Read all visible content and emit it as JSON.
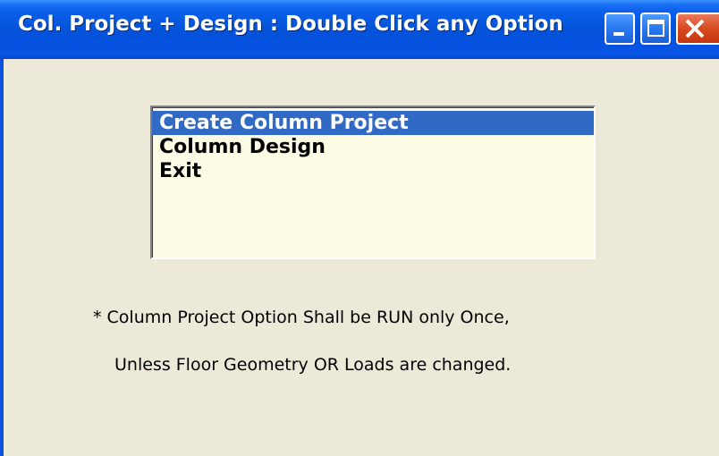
{
  "window": {
    "title": "Col. Project + Design : Double Click any Option",
    "controls": {
      "minimize": "minimize-icon",
      "maximize": "maximize-icon",
      "close": "close-icon"
    }
  },
  "options": {
    "items": [
      {
        "label": "Create Column Project",
        "selected": true
      },
      {
        "label": "Column Design",
        "selected": false
      },
      {
        "label": "Exit",
        "selected": false
      }
    ]
  },
  "note": {
    "line1": "* Column Project Option Shall be RUN only Once,",
    "line2": "Unless Floor Geometry OR Loads are changed."
  },
  "colors": {
    "titlebar": "#0453d9",
    "selection": "#316ac5",
    "listbox_bg": "#fdfde6",
    "window_bg": "#ece9d8"
  }
}
